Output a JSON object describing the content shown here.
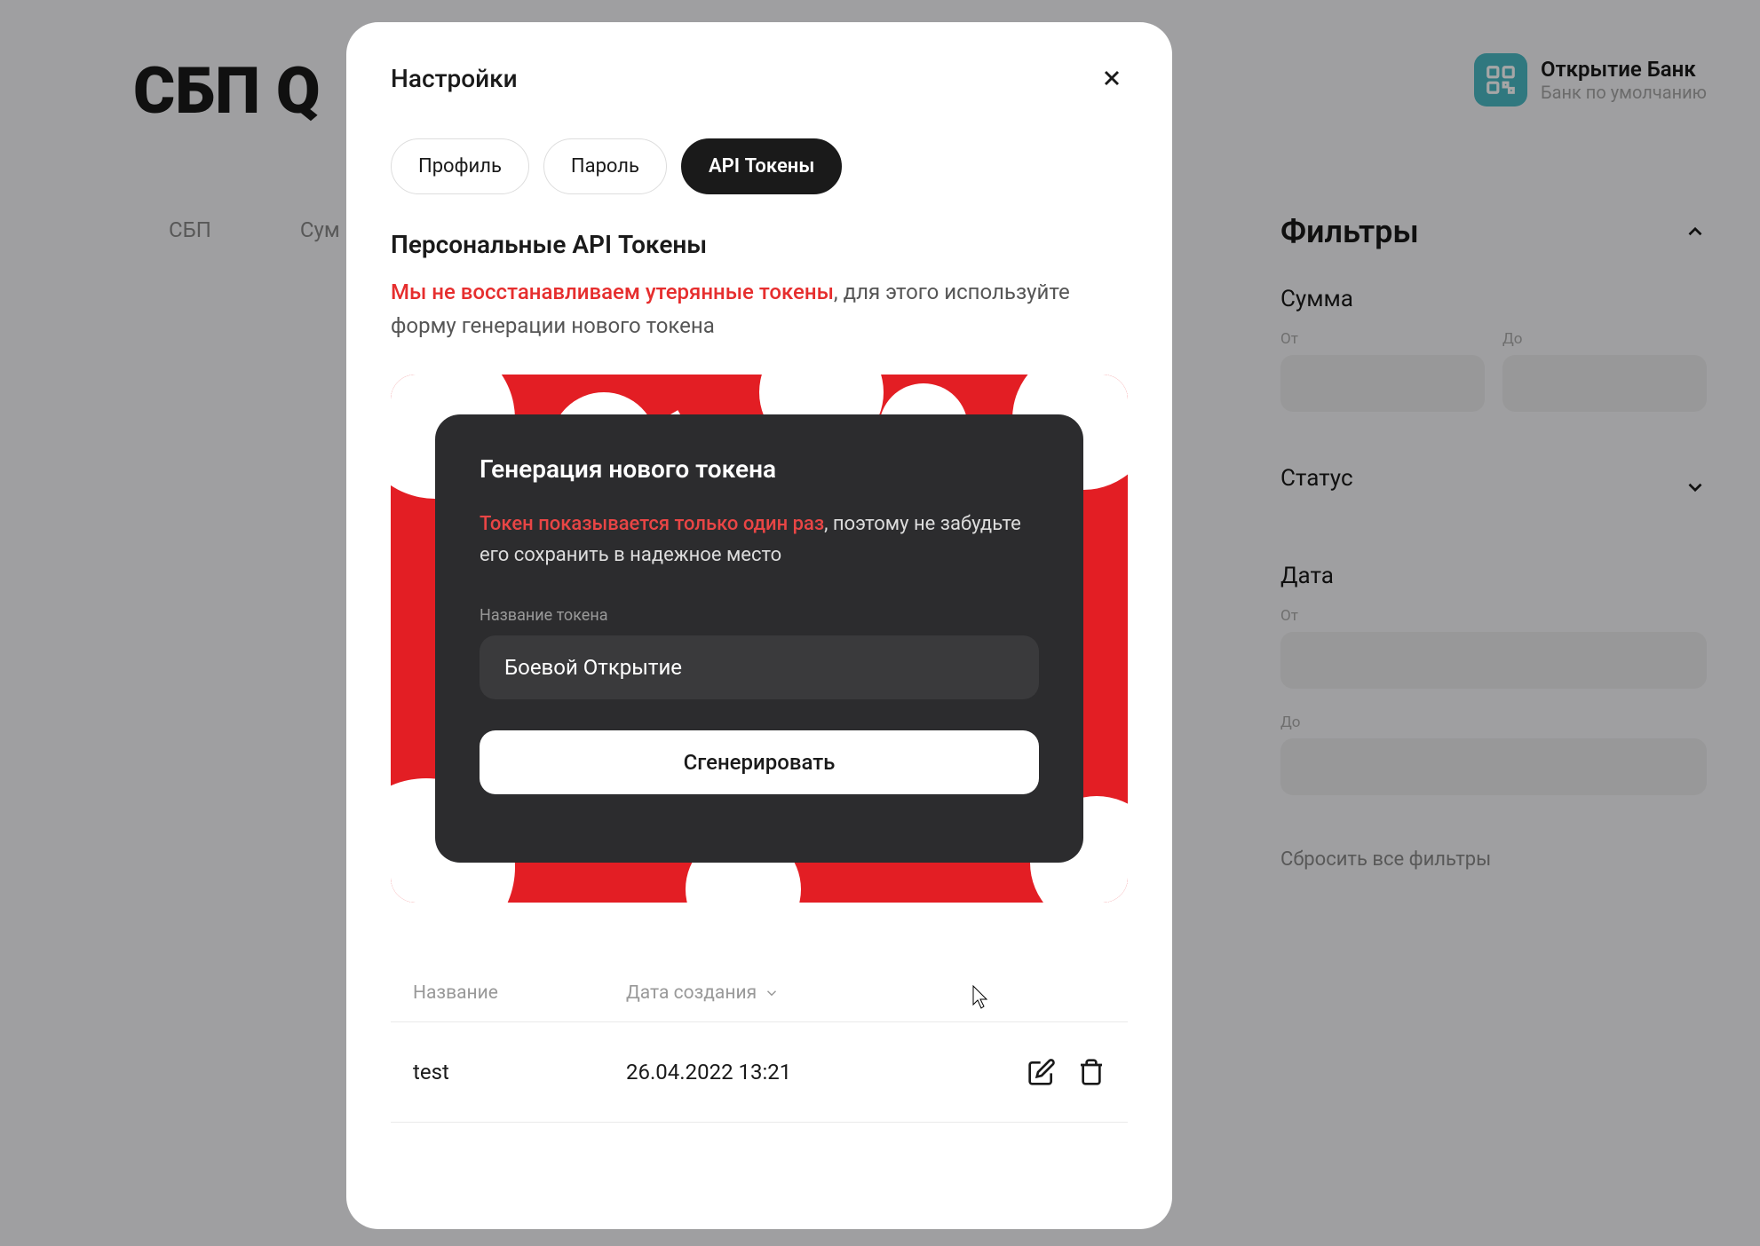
{
  "background": {
    "title": "СБП Q",
    "bankName": "Открытие Банк",
    "bankSub": "Банк по умолчанию",
    "tabs": [
      "СБП",
      "Сум"
    ]
  },
  "filters": {
    "title": "Фильтры",
    "sum": {
      "label": "Сумма",
      "fromLabel": "От",
      "toLabel": "До"
    },
    "status": {
      "label": "Статус"
    },
    "date": {
      "label": "Дата",
      "fromLabel": "От",
      "toLabel": "До"
    },
    "resetLabel": "Сбросить все фильтры"
  },
  "modal": {
    "title": "Настройки",
    "tabs": {
      "profile": "Профиль",
      "password": "Пароль",
      "apiTokens": "API Токены"
    },
    "sectionTitle": "Персональные API Токены",
    "warningRed": "Мы не восстанавливаем утерянные токены",
    "warningRest": ", для этого используйте форму генерации нового токена",
    "generation": {
      "title": "Генерация нового токена",
      "warningRed": "Токен показывается только один раз",
      "warningRest": ", поэтому не забудьте его сохранить в надежное место",
      "inputLabel": "Название токена",
      "inputValue": "Боевой Открытие",
      "buttonLabel": "Сгенерировать"
    },
    "table": {
      "headerName": "Название",
      "headerDate": "Дата создания",
      "rows": [
        {
          "name": "test",
          "date": "26.04.2022 13:21"
        }
      ]
    }
  }
}
